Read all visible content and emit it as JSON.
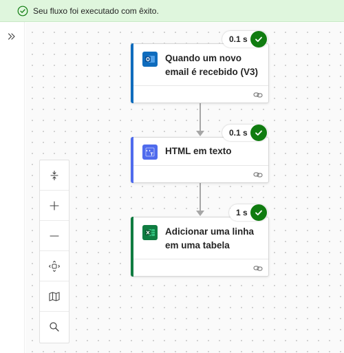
{
  "status": {
    "message": "Seu fluxo foi executado com êxito.",
    "icon": "check-circle-icon",
    "color": "#107c10"
  },
  "left_rail": {
    "expand_icon": "chevron-double-right-icon"
  },
  "flow": {
    "steps": [
      {
        "title_line1": "Quando um novo",
        "title_line2": "email é recebido (V3)",
        "duration": "0.1 s",
        "icon": "outlook-icon",
        "accent": "#0f6cbd",
        "status": "succeeded"
      },
      {
        "title_line1": "HTML em texto",
        "title_line2": "",
        "duration": "0.1 s",
        "icon": "html-to-text-icon",
        "accent": "#4f6bed",
        "status": "succeeded"
      },
      {
        "title_line1": "Adicionar uma linha",
        "title_line2": "em uma tabela",
        "duration": "1 s",
        "icon": "excel-icon",
        "accent": "#107c41",
        "status": "succeeded"
      }
    ]
  },
  "zoom_toolbar": {
    "tools": [
      "fit-vertical-icon",
      "zoom-in-icon",
      "zoom-out-icon",
      "fit-view-icon",
      "minimap-icon",
      "search-icon"
    ]
  }
}
